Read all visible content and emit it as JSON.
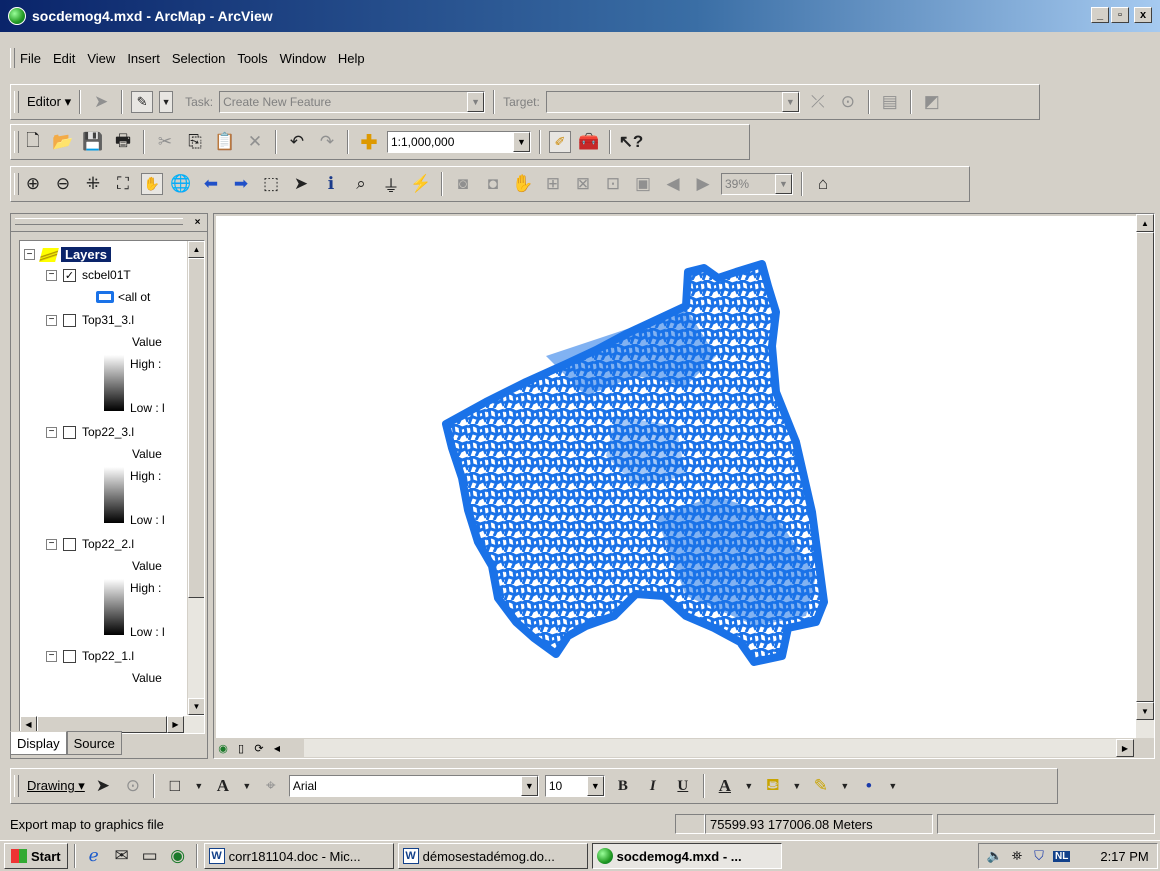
{
  "window": {
    "title": "socdemog4.mxd - ArcMap - ArcView",
    "btn_min": "_",
    "btn_max": "▫",
    "btn_close": "x"
  },
  "menu": [
    "File",
    "Edit",
    "View",
    "Insert",
    "Selection",
    "Tools",
    "Window",
    "Help"
  ],
  "editor_toolbar": {
    "editor_label": "Editor ▾",
    "task_label": "Task:",
    "task_value": "Create New Feature",
    "target_label": "Target:",
    "target_value": ""
  },
  "standard_toolbar": {
    "scale_value": "1:1,000,000"
  },
  "tools_toolbar": {
    "zoom_percent": "39%"
  },
  "toc": {
    "root_label": "Layers",
    "layers": [
      {
        "name": "scbel01T",
        "checked": true,
        "legend": "<all ot"
      },
      {
        "name": "Top31_3.l",
        "checked": false,
        "field": "Value",
        "high": "High : ",
        "low": "Low : l"
      },
      {
        "name": "Top22_3.l",
        "checked": false,
        "field": "Value",
        "high": "High : ",
        "low": "Low : l"
      },
      {
        "name": "Top22_2.l",
        "checked": false,
        "field": "Value",
        "high": "High : ",
        "low": "Low : l"
      },
      {
        "name": "Top22_1.l",
        "checked": false,
        "field": "Value"
      }
    ],
    "tabs": {
      "display": "Display",
      "source": "Source"
    }
  },
  "drawing_toolbar": {
    "drawing_label": "Drawing ▾",
    "font_name": "Arial",
    "font_size": "10",
    "bold": "B",
    "italic": "I",
    "underline": "U"
  },
  "status": {
    "message": "Export map to graphics file",
    "coords": "75599.93 177006.08 Meters"
  },
  "taskbar": {
    "start": "Start",
    "tasks": [
      "corr181104.doc - Mic...",
      "démosestadémog.do...",
      "socdemog4.mxd - ..."
    ],
    "lang": "NL",
    "clock": "2:17 PM"
  },
  "colors": {
    "polygon_outline": "#1a72e8",
    "titlebar": "#0a246a"
  }
}
